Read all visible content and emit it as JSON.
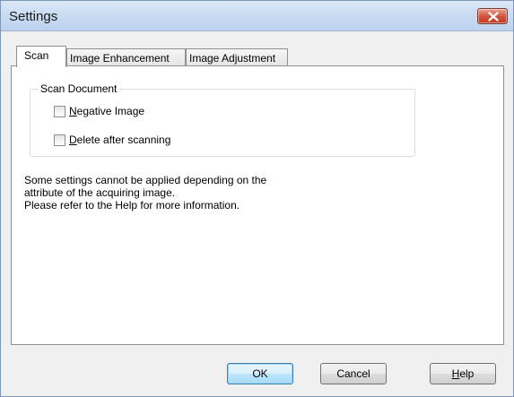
{
  "window": {
    "title": "Settings"
  },
  "tabs": [
    {
      "label": "Scan",
      "active": true
    },
    {
      "label": "Image Enhancement",
      "active": false
    },
    {
      "label": "Image Adjustment",
      "active": false
    }
  ],
  "scan_document": {
    "label": "Scan Document",
    "negative_image": {
      "mnemonic": "N",
      "rest": "egative Image",
      "checked": false
    },
    "delete_after_scanning": {
      "mnemonic": "D",
      "rest": "elete after scanning",
      "checked": false
    }
  },
  "info": {
    "line1": "Some settings cannot be applied depending on the",
    "line2": "attribute of the acquiring image.",
    "line3": "Please refer to the Help for more information."
  },
  "buttons": {
    "ok": "OK",
    "cancel": "Cancel",
    "help_mnemonic": "H",
    "help_rest": "elp"
  },
  "icons": {
    "close": "close-icon"
  }
}
